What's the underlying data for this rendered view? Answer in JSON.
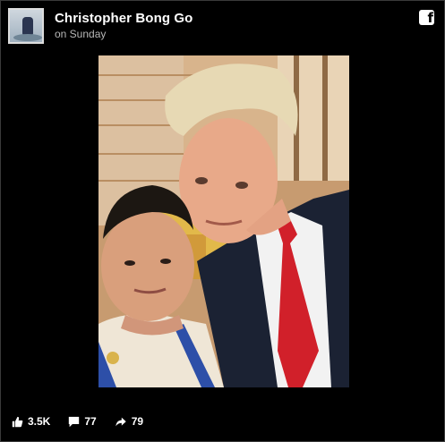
{
  "post": {
    "author": "Christopher Bong Go",
    "timestamp": "on Sunday"
  },
  "icons": {
    "brand": "facebook-icon",
    "like": "thumbs-up-icon",
    "comment": "comment-bubble-icon",
    "share": "share-arrow-icon"
  },
  "stats": {
    "likes": "3.5K",
    "comments": "77",
    "shares": "79"
  },
  "colors": {
    "background": "#000000",
    "text": "#ffffff",
    "subtext": "#b7b7b7"
  }
}
